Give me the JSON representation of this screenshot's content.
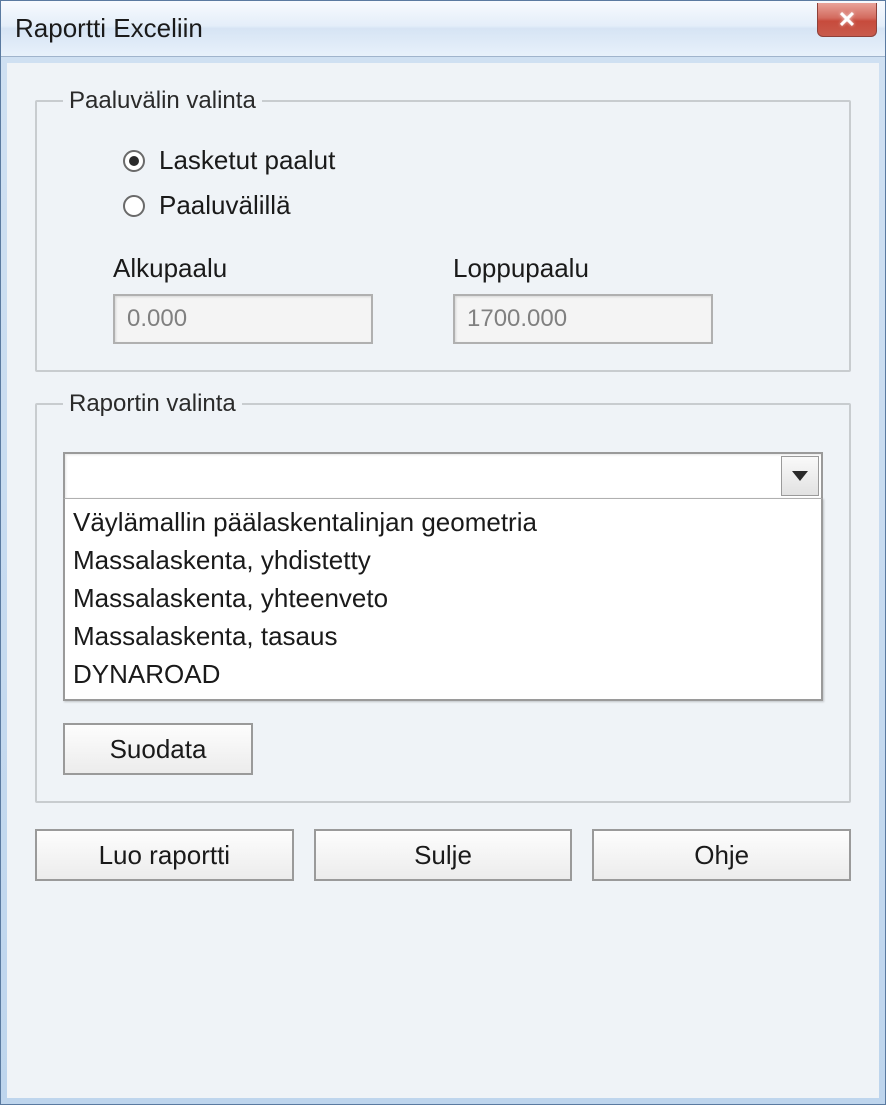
{
  "window": {
    "title": "Raportti Exceliin"
  },
  "group_paaluvalin": {
    "legend": "Paaluvälin valinta",
    "radio_lasketut": "Lasketut paalut",
    "radio_paaluvalilla": "Paaluvälillä",
    "alkupaalu_label": "Alkupaalu",
    "alkupaalu_value": "0.000",
    "loppupaalu_label": "Loppupaalu",
    "loppupaalu_value": "1700.000"
  },
  "group_raportin": {
    "legend": "Raportin valinta",
    "combo_value": "",
    "options": {
      "0": "Väylämallin päälaskentalinjan geometria",
      "1": "Massalaskenta, yhdistetty",
      "2": "Massalaskenta, yhteenveto",
      "3": "Massalaskenta, tasaus",
      "4": "DYNAROAD"
    },
    "filter_label": "Suodata"
  },
  "buttons": {
    "create": "Luo raportti",
    "close": "Sulje",
    "help": "Ohje"
  }
}
